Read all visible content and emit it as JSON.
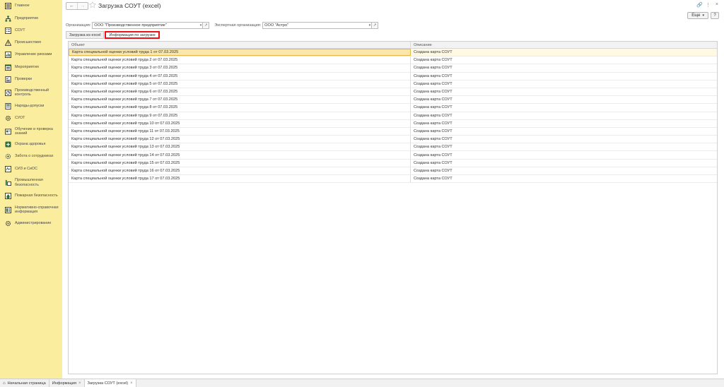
{
  "sidebar": {
    "items": [
      {
        "label": "Главное",
        "icon": "menu-lines-icon"
      },
      {
        "label": "Предприятие",
        "icon": "org-chart-icon"
      },
      {
        "label": "СОУТ",
        "icon": "document-list-icon"
      },
      {
        "label": "Происшествия",
        "icon": "warning-triangle-icon"
      },
      {
        "label": "Управление рисками",
        "icon": "chart-icon"
      },
      {
        "label": "Мероприятия",
        "icon": "calendar-list-icon"
      },
      {
        "label": "Проверки",
        "icon": "checklist-icon"
      },
      {
        "label": "Производственный контроль",
        "icon": "control-icon"
      },
      {
        "label": "Наряды-допуски",
        "icon": "permit-icon"
      },
      {
        "label": "СУОТ",
        "icon": "gear-icon"
      },
      {
        "label": "Обучение и проверка знаний",
        "icon": "education-icon"
      },
      {
        "label": "Охрана здоровья",
        "icon": "health-icon"
      },
      {
        "label": "Забота о сотрудниках",
        "icon": "care-icon"
      },
      {
        "label": "СИЗ и СиОС",
        "icon": "ppe-icon"
      },
      {
        "label": "Промышленная безопасность",
        "icon": "industry-icon"
      },
      {
        "label": "Пожарная безопасность",
        "icon": "fire-icon"
      },
      {
        "label": "Нормативно-справочная информация",
        "icon": "reference-icon"
      },
      {
        "label": "Администрирование",
        "icon": "admin-gear-icon"
      }
    ]
  },
  "header": {
    "title": "Загрузка СОУТ (excel)",
    "more_label": "Еще",
    "help_label": "?"
  },
  "form": {
    "org_label": "Организация:",
    "org_value": "ООО \"Производственное предприятие\"",
    "expert_label": "Экспертная организация:",
    "expert_value": "ООО \"Астро\""
  },
  "tabs": [
    {
      "label": "Загрузка из excel",
      "active": false
    },
    {
      "label": "Информация по загрузке",
      "active": true
    }
  ],
  "table": {
    "columns": [
      "Объект",
      "Описание"
    ],
    "rows": [
      [
        "Карта специальной оценки условий труда 1 от 07.03.2025",
        "Создана карта СОУТ"
      ],
      [
        "Карта специальной оценки условий труда 2 от 07.03.2025",
        "Создана карта СОУТ"
      ],
      [
        "Карта специальной оценки условий труда 3 от 07.03.2025",
        "Создана карта СОУТ"
      ],
      [
        "Карта специальной оценки условий труда 4 от 07.03.2025",
        "Создана карта СОУТ"
      ],
      [
        "Карта специальной оценки условий труда 5 от 07.03.2025",
        "Создана карта СОУТ"
      ],
      [
        "Карта специальной оценки условий труда 6 от 07.03.2025",
        "Создана карта СОУТ"
      ],
      [
        "Карта специальной оценки условий труда 7 от 07.03.2025",
        "Создана карта СОУТ"
      ],
      [
        "Карта специальной оценки условий труда 8 от 07.03.2025",
        "Создана карта СОУТ"
      ],
      [
        "Карта специальной оценки условий труда 9 от 07.03.2025",
        "Создана карта СОУТ"
      ],
      [
        "Карта специальной оценки условий труда 10 от 07.03.2025",
        "Создана карта СОУТ"
      ],
      [
        "Карта специальной оценки условий труда 11 от 07.03.2025",
        "Создана карта СОУТ"
      ],
      [
        "Карта специальной оценки условий труда 12 от 07.03.2025",
        "Создана карта СОУТ"
      ],
      [
        "Карта специальной оценки условий труда 13 от 07.03.2025",
        "Создана карта СОУТ"
      ],
      [
        "Карта специальной оценки условий труда 14 от 07.03.2025",
        "Создана карта СОУТ"
      ],
      [
        "Карта специальной оценки условий труда 15 от 07.03.2025",
        "Создана карта СОУТ"
      ],
      [
        "Карта специальной оценки условий труда 16 от 07.03.2025",
        "Создана карта СОУТ"
      ],
      [
        "Карта специальной оценки условий труда 17 от 07.03.2025",
        "Создана карта СОУТ"
      ]
    ]
  },
  "taskbar": {
    "items": [
      {
        "label": "Начальная страница",
        "active": false
      },
      {
        "label": "Информация",
        "active": false
      },
      {
        "label": "Загрузка СОУТ (excel)",
        "active": true
      }
    ]
  },
  "colors": {
    "sidebar_bg": "#fbed9e",
    "selection": "#fbe7a9",
    "highlight_border": "#ee1111"
  }
}
